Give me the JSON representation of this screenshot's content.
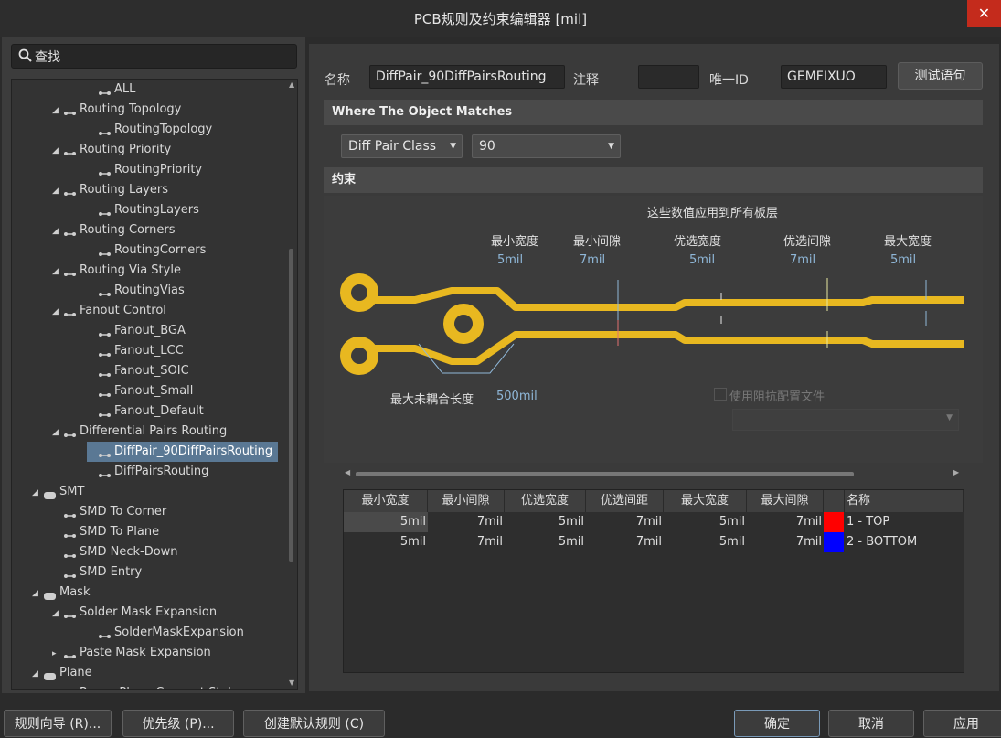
{
  "window": {
    "title": "PCB规则及约束编辑器 [mil]",
    "close": "✕"
  },
  "search": {
    "placeholder": "查找"
  },
  "tree": [
    {
      "label": "ALL",
      "level": 2,
      "arrow": ""
    },
    {
      "label": "Routing Topology",
      "level": 1,
      "arrow": "◢"
    },
    {
      "label": "RoutingTopology",
      "level": 2,
      "arrow": ""
    },
    {
      "label": "Routing Priority",
      "level": 1,
      "arrow": "◢"
    },
    {
      "label": "RoutingPriority",
      "level": 2,
      "arrow": ""
    },
    {
      "label": "Routing Layers",
      "level": 1,
      "arrow": "◢"
    },
    {
      "label": "RoutingLayers",
      "level": 2,
      "arrow": ""
    },
    {
      "label": "Routing Corners",
      "level": 1,
      "arrow": "◢"
    },
    {
      "label": "RoutingCorners",
      "level": 2,
      "arrow": ""
    },
    {
      "label": "Routing Via Style",
      "level": 1,
      "arrow": "◢"
    },
    {
      "label": "RoutingVias",
      "level": 2,
      "arrow": ""
    },
    {
      "label": "Fanout Control",
      "level": 1,
      "arrow": "◢"
    },
    {
      "label": "Fanout_BGA",
      "level": 2,
      "arrow": ""
    },
    {
      "label": "Fanout_LCC",
      "level": 2,
      "arrow": ""
    },
    {
      "label": "Fanout_SOIC",
      "level": 2,
      "arrow": ""
    },
    {
      "label": "Fanout_Small",
      "level": 2,
      "arrow": ""
    },
    {
      "label": "Fanout_Default",
      "level": 2,
      "arrow": ""
    },
    {
      "label": "Differential Pairs Routing",
      "level": 1,
      "arrow": "◢"
    },
    {
      "label": "DiffPair_90DiffPairsRouting",
      "level": 2,
      "arrow": "",
      "selected": true
    },
    {
      "label": "DiffPairsRouting",
      "level": 2,
      "arrow": ""
    },
    {
      "label": "SMT",
      "level": 0,
      "arrow": "◢"
    },
    {
      "label": "SMD To Corner",
      "level": 1,
      "arrow": ""
    },
    {
      "label": "SMD To Plane",
      "level": 1,
      "arrow": ""
    },
    {
      "label": "SMD Neck-Down",
      "level": 1,
      "arrow": ""
    },
    {
      "label": "SMD Entry",
      "level": 1,
      "arrow": ""
    },
    {
      "label": "Mask",
      "level": 0,
      "arrow": "◢"
    },
    {
      "label": "Solder Mask Expansion",
      "level": 1,
      "arrow": "◢"
    },
    {
      "label": "SolderMaskExpansion",
      "level": 2,
      "arrow": ""
    },
    {
      "label": "Paste Mask Expansion",
      "level": 1,
      "arrow": "▸"
    },
    {
      "label": "Plane",
      "level": 0,
      "arrow": "◢"
    },
    {
      "label": "Power Plane Connect Style",
      "level": 1,
      "arrow": "◢"
    }
  ],
  "form": {
    "name_label": "名称",
    "name_value": "DiffPair_90DiffPairsRouting",
    "comment_label": "注释",
    "comment_value": "",
    "uid_label": "唯一ID",
    "uid_value": "GEMFIXUO",
    "test_button": "测试语句"
  },
  "match": {
    "section_title": "Where The Object Matches",
    "type_value": "Diff Pair Class",
    "class_value": "90"
  },
  "constraints": {
    "section_title": "约束",
    "header_note": "这些数值应用到所有板层",
    "labels": [
      "最小宽度",
      "最小间隙",
      "优选宽度",
      "优选间隙",
      "最大宽度"
    ],
    "values": [
      "5mil",
      "7mil",
      "5mil",
      "7mil",
      "5mil"
    ],
    "max_uncoupled_label": "最大未耦合长度",
    "max_uncoupled_value": "500mil",
    "impedance_label": "使用阻抗配置文件"
  },
  "layer_table": {
    "headers": [
      "最小宽度",
      "最小间隙",
      "优选宽度",
      "优选间距",
      "最大宽度",
      "最大间隙",
      "",
      "名称"
    ],
    "rows": [
      {
        "cells": [
          "5mil",
          "7mil",
          "5mil",
          "7mil",
          "5mil",
          "7mil"
        ],
        "color": "#ff0000",
        "name": "1 - TOP"
      },
      {
        "cells": [
          "5mil",
          "7mil",
          "5mil",
          "7mil",
          "5mil",
          "7mil"
        ],
        "color": "#0000ff",
        "name": "2 - BOTTOM"
      }
    ]
  },
  "footer": {
    "wizard": "规则向导 (R)...",
    "priority": "优先级 (P)...",
    "create_default": "创建默认规则 (C)",
    "ok": "确定",
    "cancel": "取消",
    "apply": "应用"
  },
  "colors": {
    "trace": "#e8b820",
    "selected": "#5a7894",
    "close": "#c42b1c"
  }
}
